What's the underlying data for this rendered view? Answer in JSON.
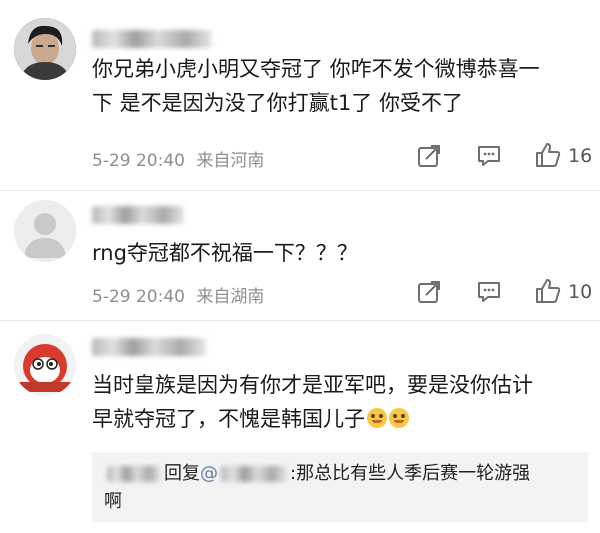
{
  "comments": [
    {
      "text_line1": "你兄弟小虎小明又夺冠了 你咋不发个微博恭喜一",
      "text_line2": "下 是不是因为没了你打赢t1了 你受不了",
      "date": "5-29 20:40",
      "location": "来自河南",
      "like_count": "16"
    },
    {
      "text_line1": "rng夺冠都不祝福一下？？？",
      "date": "5-29 20:40",
      "location": "来自湖南",
      "like_count": "10"
    },
    {
      "text_line1": "当时皇族是因为有你才是亚军吧，要是没你估计",
      "text_line2": "早就夺冠了，不愧是韩国儿子",
      "emojis": [
        "doge-emoji",
        "doge-emoji"
      ],
      "reply": {
        "reply_word": "回复",
        "at": "@",
        "text_line1": ":那总比有些人季后赛一轮游强",
        "text_line2": "啊"
      }
    }
  ],
  "colors": {
    "meta_text": "#8f8f8f",
    "mention": "#5d7fae",
    "reply_bg": "#f3f3f3"
  },
  "icons": [
    "repost-icon",
    "comment-icon",
    "like-icon"
  ]
}
